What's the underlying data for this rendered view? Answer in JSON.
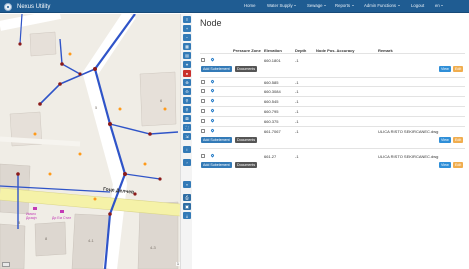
{
  "navbar": {
    "brand": "Nexus Utility",
    "items": [
      "Home",
      "Water Supply",
      "Sewage",
      "Reports",
      "Admin Functions",
      "Logout",
      "en"
    ]
  },
  "map": {
    "scale": "1 : 500",
    "labels": {
      "street": "Гоце Делчев",
      "poi_1": "Имаго Дизајн",
      "poi_2": "Ди Ем Стил"
    },
    "colors": {
      "pipe": "#2f54c8",
      "background": "#f0ede6",
      "road": "#ffffff",
      "highlight": "#f5f2a8",
      "building": "#ddd7d0"
    }
  },
  "panel": {
    "title": "Node",
    "headers": [
      "Pressure Zone",
      "Elevation",
      "Depth",
      "Node Pos. Accuracy",
      "Remark"
    ],
    "rows": [
      {
        "elevation": "660.1801",
        "depth": "-1",
        "remark": "",
        "actions": true
      },
      {
        "elevation": "660.585",
        "depth": "-1",
        "remark": "",
        "actions": false
      },
      {
        "elevation": "660.3084",
        "depth": "-1",
        "remark": "",
        "actions": false
      },
      {
        "elevation": "660.545",
        "depth": "-1",
        "remark": "",
        "actions": false
      },
      {
        "elevation": "660.795",
        "depth": "-1",
        "remark": "",
        "actions": false
      },
      {
        "elevation": "660.375",
        "depth": "-1",
        "remark": "",
        "actions": false
      },
      {
        "elevation": "661.7067",
        "depth": "-1",
        "remark": "ULICA RISTO SEKIRCANEC.dwg",
        "actions": true
      },
      {
        "elevation": "661.27",
        "depth": "-1",
        "remark": "ULICA RISTO SEKIRCANEC.dwg",
        "actions": true
      }
    ],
    "buttons": {
      "add_subelement": "Add Subelement",
      "documents": "Documents",
      "view": "View",
      "edit": "Edit"
    }
  },
  "toolbar": {
    "icons": [
      "layers-icon",
      "plus-icon",
      "minus-icon",
      "map-icon",
      "grid-icon",
      "pin-icon",
      "delete-icon",
      "zoom-in-icon",
      "zoom-out-icon",
      "search-icon",
      "search-icon",
      "measure-icon",
      "fullscreen-icon",
      "expand-icon",
      "arrow-icon",
      "print-icon",
      "save-icon",
      "export-icon"
    ]
  }
}
